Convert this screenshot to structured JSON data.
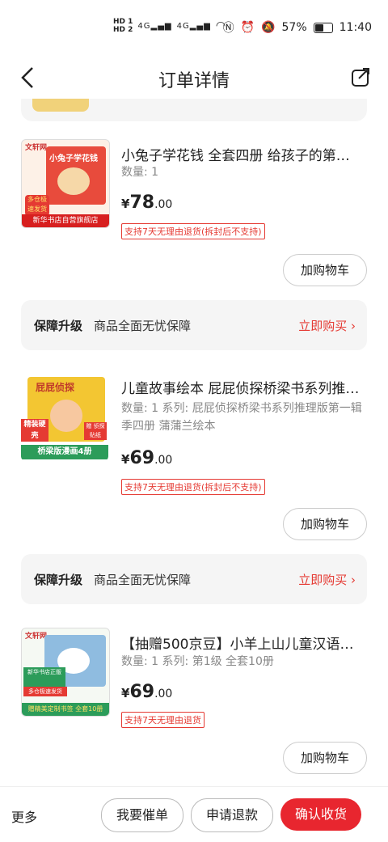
{
  "status_bar": {
    "hd1": "HD 1",
    "hd2": "HD 2",
    "signal1": "4G",
    "signal2": "4G",
    "battery_pct": "57%",
    "time": "11:40"
  },
  "nav": {
    "back_icon": "chevron-left-icon",
    "title": "订单详情",
    "share_icon": "share-icon"
  },
  "products": [
    {
      "title": "小兔子学花钱 全套四册 给孩子的第…",
      "meta": "数量: 1",
      "price_cur": "¥",
      "price_int": "78",
      "price_dec": ".00",
      "tag": "支持7天无理由退货(拆封后不支持)",
      "cart_label": "加购物车",
      "thumb_text": "小兔子学花钱",
      "thumb_badge": "新华书店自营旗舰店",
      "thumb_corner": "文轩网",
      "thumb_promo": "多仓极速发货"
    },
    {
      "title": "儿童故事绘本 屁屁侦探桥梁书系列推…",
      "meta": "数量: 1  系列: 屁屁侦探桥梁书系列推理版第一辑季四册 蒲蒲兰绘本",
      "price_cur": "¥",
      "price_int": "69",
      "price_dec": ".00",
      "tag": "支持7天无理由退货(拆封后不支持)",
      "cart_label": "加购物车",
      "thumb_text": "屁屁侦探",
      "thumb_badge": "桥梁版漫画4册",
      "thumb_corner": "精装硬壳",
      "thumb_promo": "赠 侦探贴纸"
    },
    {
      "title": "【抽赠500京豆】小羊上山儿童汉语…",
      "meta": "数量: 1  系列: 第1级 全套10册",
      "price_cur": "¥",
      "price_int": "69",
      "price_dec": ".00",
      "tag": "支持7天无理由退货",
      "cart_label": "加购物车",
      "thumb_text": "新华书店正版",
      "thumb_badge": "赠精美定制书签 全套10册",
      "thumb_corner": "文轩网",
      "thumb_promo": "多仓极速发货"
    }
  ],
  "guarantee": {
    "label": "保障升级",
    "desc": "商品全面无忧保障",
    "buy": "立即购买 ›"
  },
  "bottom_bar": {
    "more": "更多",
    "urge": "我要催单",
    "refund": "申请退款",
    "confirm": "确认收货"
  },
  "colors": {
    "accent": "#e8262f",
    "tag": "#e53a33"
  }
}
